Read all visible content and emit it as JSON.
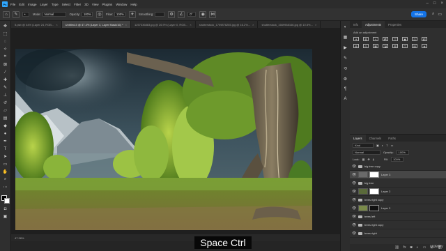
{
  "menu": {
    "logo": "Ps",
    "items": [
      "File",
      "Edit",
      "Image",
      "Layer",
      "Type",
      "Select",
      "Filter",
      "3D",
      "View",
      "Plugins",
      "Window",
      "Help"
    ]
  },
  "options": {
    "mode_label": "Mode:",
    "mode_value": "Normal",
    "opacity_label": "Opacity:",
    "opacity_value": "100%",
    "flow_label": "Flow:",
    "flow_value": "100%",
    "smoothing_label": "Smoothing:",
    "angle_value": "0°",
    "share_label": "Share"
  },
  "tabs": [
    {
      "label": "5.psb @ 44% (Layer 24, RGB...",
      "active": false
    },
    {
      "label": "Untitled-5 @ 47.4% (Layer 3, Layer Mask/16) *",
      "active": true
    },
    {
      "label": "1257336883.jpg @ 26.9% (Layer 0, RGB...",
      "active": false
    },
    {
      "label": "shutterstock_1709876265.jpg @ 16.2%...",
      "active": false
    },
    {
      "label": "shutterstock_1669968166.jpg @ 10.5%...",
      "active": false
    }
  ],
  "panels": {
    "top_tabs": [
      "Info",
      "Adjustments",
      "Properties"
    ],
    "adjust_label": "Add an adjustment",
    "layers_tabs": [
      "Layers",
      "Channels",
      "Paths"
    ],
    "kind_label": "Kind",
    "blend_mode": "Normal",
    "opacity_label": "Opacity:",
    "opacity_value": "100%",
    "fill_label": "Fill:",
    "fill_value": "100%",
    "lock_label": "Lock:"
  },
  "layers": [
    {
      "name": "big tree copy",
      "type": "folder",
      "selected": false
    },
    {
      "name": "Layer 3",
      "type": "layer",
      "selected": true
    },
    {
      "name": "big tree",
      "type": "folder",
      "selected": false
    },
    {
      "name": "Layer 2",
      "type": "layer",
      "selected": false
    },
    {
      "name": "trees right copy",
      "type": "folder",
      "selected": false
    },
    {
      "name": "Layer 2",
      "type": "layer",
      "selected": false
    },
    {
      "name": "trees left",
      "type": "folder",
      "selected": false
    },
    {
      "name": "trees right copy",
      "type": "folder",
      "selected": false
    },
    {
      "name": "trees right",
      "type": "folder",
      "selected": false
    }
  ],
  "status": {
    "text": "47.38%"
  },
  "caption": "Space Ctrl",
  "watermark": "Udemy"
}
